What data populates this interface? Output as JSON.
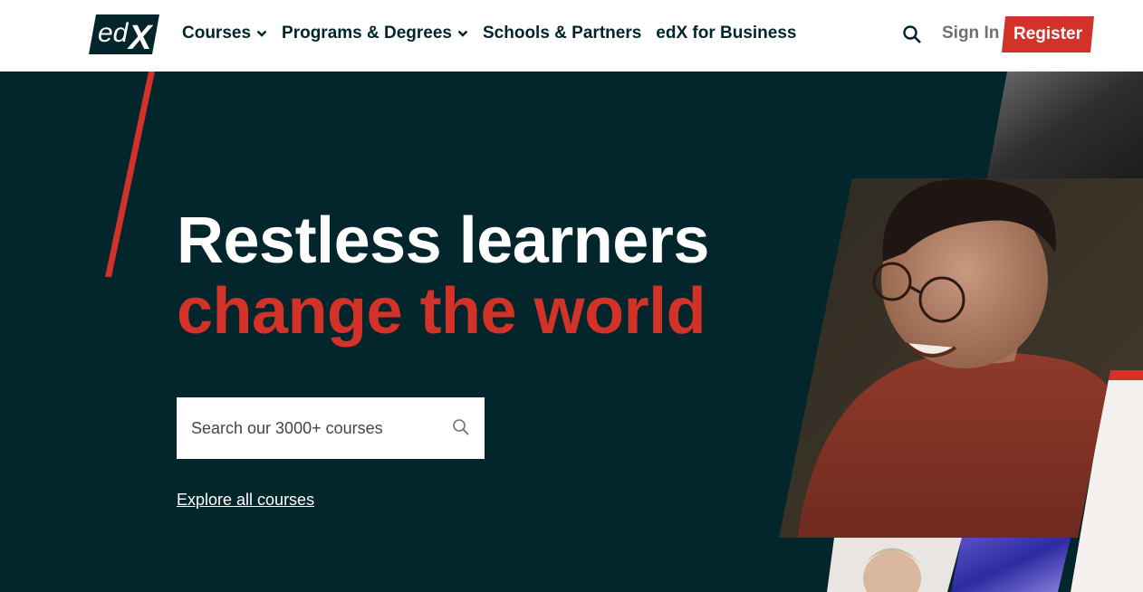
{
  "header": {
    "logo_text": "edX",
    "nav": [
      {
        "label": "Courses",
        "has_dropdown": true
      },
      {
        "label": "Programs & Degrees",
        "has_dropdown": true
      },
      {
        "label": "Schools & Partners",
        "has_dropdown": false
      },
      {
        "label": "edX for Business",
        "has_dropdown": false
      }
    ],
    "search_icon": "search-icon",
    "signin_label": "Sign In",
    "register_label": "Register"
  },
  "hero": {
    "headline_line1": "Restless learners",
    "headline_line2": "change the world",
    "search_placeholder": "Search our 3000+ courses",
    "explore_link": "Explore all courses"
  },
  "colors": {
    "brand_dark": "#02262b",
    "accent_red": "#d23228",
    "nav_text": "#00262b"
  }
}
